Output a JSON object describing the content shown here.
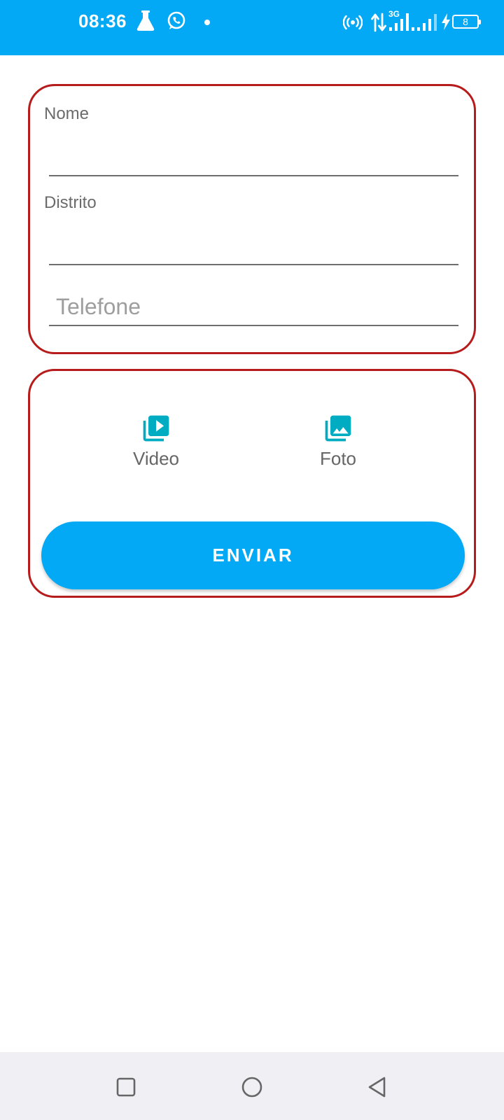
{
  "status_bar": {
    "time": "08:36",
    "battery_level": "8",
    "network_type": "3G",
    "background_color": "#03A9F4",
    "icons": [
      "flask-icon",
      "whatsapp-icon",
      "notification-dot-icon",
      "hotspot-icon",
      "data-arrows-icon",
      "signal-3g-icon",
      "signal-icon",
      "charging-icon",
      "battery-icon"
    ]
  },
  "form": {
    "name_label": "Nome",
    "name_value": "",
    "district_label": "Distrito",
    "district_value": "",
    "phone_placeholder": "Telefone",
    "phone_value": ""
  },
  "media": {
    "video_label": "Video",
    "photo_label": "Foto",
    "icon_color": "#00ACC1"
  },
  "actions": {
    "send_label": "ENVIAR",
    "button_color": "#03A9F4"
  },
  "card_border_color": "#B71C1C",
  "nav_bar": {
    "icons": [
      "square-recent-apps-icon",
      "circle-home-icon",
      "triangle-back-icon"
    ]
  }
}
